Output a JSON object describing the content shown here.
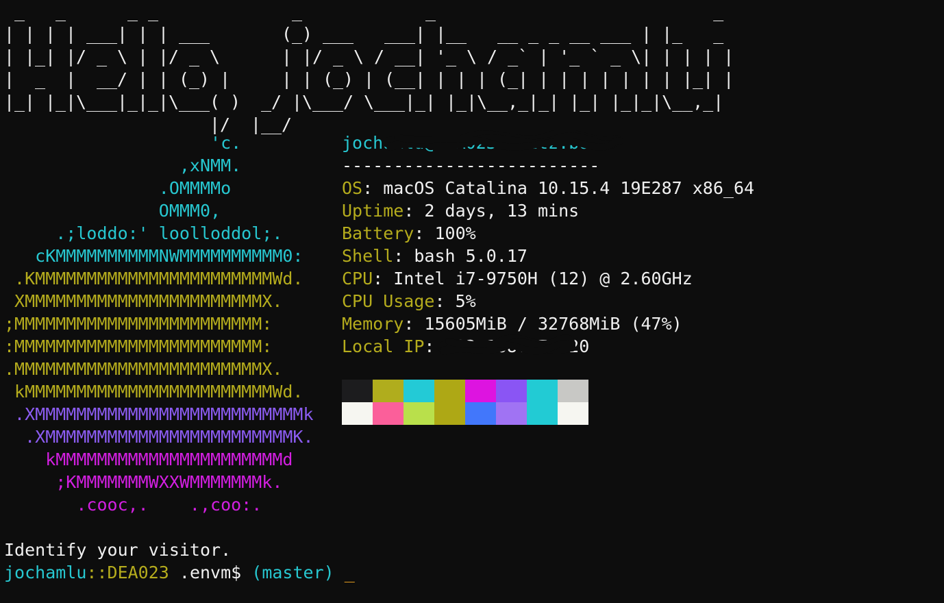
{
  "window": {
    "background": "#0d0d0d"
  },
  "banner": {
    "lines": [
      " _   _      _ _             _            _                           _",
      "| | | | ___| | | ___       (_) ___   ___| |__   __ _ _ __ ___ | |_   _",
      "| |_| |/ _ \\ | |/ _ \\      | |/ _ \\ / __| '_ \\ / _` | '_ ` _ \\| | | | |",
      "|  _  |  __/ | | (_) |     | | (_) | (__| | | | (_| | | | | | | | |_| |",
      "|_| |_|\\___|_|_|\\___( )  _/ |\\___/ \\___|_| |_|\\__,_|_| |_| |_|_|\\__,_|",
      "                    |/  |__/"
    ]
  },
  "logo": {
    "lines": [
      {
        "text": "                    'c.",
        "color": "cyan"
      },
      {
        "text": "                 ,xNMM.",
        "color": "cyan"
      },
      {
        "text": "               .OMMMMo",
        "color": "cyan"
      },
      {
        "text": "               OMMM0,",
        "color": "cyan"
      },
      {
        "text": "     .;loddo:' loolloddol;.",
        "color": "cyan"
      },
      {
        "text": "   cKMMMMMMMMMMNWMMMMMMMMMM0:",
        "color": "cyan"
      },
      {
        "text": " .KMMMMMMMMMMMMMMMMMMMMMMMWd.",
        "color": "olive"
      },
      {
        "text": " XMMMMMMMMMMMMMMMMMMMMMMMX.",
        "color": "olive"
      },
      {
        "text": ";MMMMMMMMMMMMMMMMMMMMMMMM:",
        "color": "olive"
      },
      {
        "text": ":MMMMMMMMMMMMMMMMMMMMMMMM:",
        "color": "olive"
      },
      {
        "text": ".MMMMMMMMMMMMMMMMMMMMMMMMX.",
        "color": "olive"
      },
      {
        "text": " kMMMMMMMMMMMMMMMMMMMMMMMMWd.",
        "color": "olive"
      },
      {
        "text": " .XMMMMMMMMMMMMMMMMMMMMMMMMMMk",
        "color": "purple"
      },
      {
        "text": "  .XMMMMMMMMMMMMMMMMMMMMMMMMK.",
        "color": "purple"
      },
      {
        "text": "    kMMMMMMMMMMMMMMMMMMMMMMd",
        "color": "magenta"
      },
      {
        "text": "     ;KMMMMMMMWXXWMMMMMMMk.",
        "color": "magenta"
      },
      {
        "text": "       .cooc,.    .,coo:.",
        "color": "magenta"
      }
    ]
  },
  "info": {
    "user_host": "jochamlu@DEA023.fritz.box",
    "separator": "-------------------------",
    "fields": [
      {
        "label": "OS",
        "value": "macOS Catalina 10.15.4 19E287 x86_64"
      },
      {
        "label": "Uptime",
        "value": "2 days, 13 mins"
      },
      {
        "label": "Battery",
        "value": "100%"
      },
      {
        "label": "Shell",
        "value": "bash 5.0.17"
      },
      {
        "label": "CPU",
        "value": "Intel i7-9750H (12) @ 2.60GHz"
      },
      {
        "label": "CPU Usage",
        "value": "5%"
      },
      {
        "label": "Memory",
        "value": "15605MiB / 32768MiB (47%)"
      },
      {
        "label": "Local IP",
        "value": "192.168.178.20"
      }
    ]
  },
  "palette": {
    "row1": [
      "#1c1c1e",
      "#b0ad1d",
      "#23cad6",
      "#aea815",
      "#dd14e0",
      "#8a55f4",
      "#22cbd4",
      "#c8c8c5"
    ],
    "row2": [
      "#f6f6f1",
      "#fb5f9a",
      "#b9e04b",
      "#aea815",
      "#4277fb",
      "#a073f3",
      "#22cbd4",
      "#f6f6f1"
    ]
  },
  "colors": {
    "cyan": "#27c7d0",
    "olive": "#b5ac1d",
    "purple": "#8c5cf2",
    "magenta": "#d21fe0",
    "cursor": "#e8a020"
  },
  "message": "Identify your visitor.",
  "prompt": {
    "user": "jochamlu",
    "separator": "::",
    "host": "DEA023",
    "directory": " .envm$ ",
    "branch": "(master)",
    "cursor": "_"
  }
}
